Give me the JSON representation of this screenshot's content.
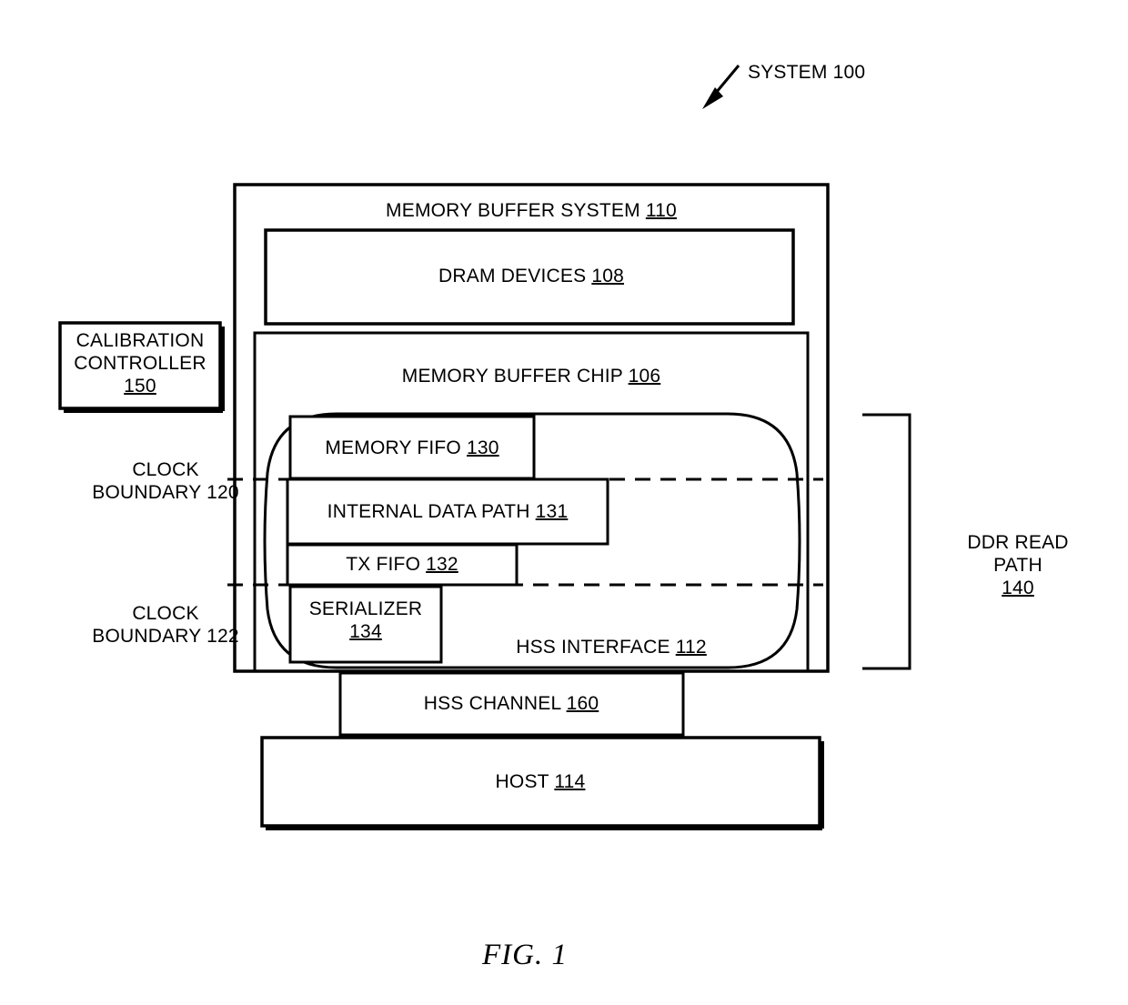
{
  "figure": {
    "caption": "FIG. 1",
    "callout": {
      "label": "SYSTEM 100",
      "icon": "arrow-pointer-icon"
    }
  },
  "blocks": {
    "memory_buffer_system": {
      "text": "MEMORY BUFFER SYSTEM ",
      "ref": "110"
    },
    "dram_devices": {
      "text": "DRAM DEVICES ",
      "ref": "108"
    },
    "memory_buffer_chip": {
      "text": "MEMORY BUFFER CHIP ",
      "ref": "106"
    },
    "memory_fifo": {
      "text": "MEMORY FIFO ",
      "ref": "130"
    },
    "internal_data_path": {
      "text": "INTERNAL DATA PATH ",
      "ref": "131"
    },
    "tx_fifo": {
      "text": "TX FIFO ",
      "ref": "132"
    },
    "serializer": {
      "text": "SERIALIZER",
      "ref": "134"
    },
    "hss_interface": {
      "text": "HSS INTERFACE  ",
      "ref": "112"
    },
    "hss_channel": {
      "text": "HSS CHANNEL ",
      "ref": "160"
    },
    "host": {
      "text": "HOST  ",
      "ref": "114"
    },
    "calibration_controller": {
      "line1": "CALIBRATION",
      "line2": "CONTROLLER",
      "ref": "150"
    }
  },
  "annotations": {
    "clock_boundary_120": {
      "line1": "CLOCK",
      "line2": "BOUNDARY 120"
    },
    "clock_boundary_122": {
      "line1": "CLOCK",
      "line2": "BOUNDARY 122"
    },
    "ddr_read_path": {
      "line1": "DDR READ",
      "line2": "PATH",
      "ref": "140"
    }
  },
  "colors": {
    "stroke": "#000000",
    "background": "#ffffff"
  }
}
